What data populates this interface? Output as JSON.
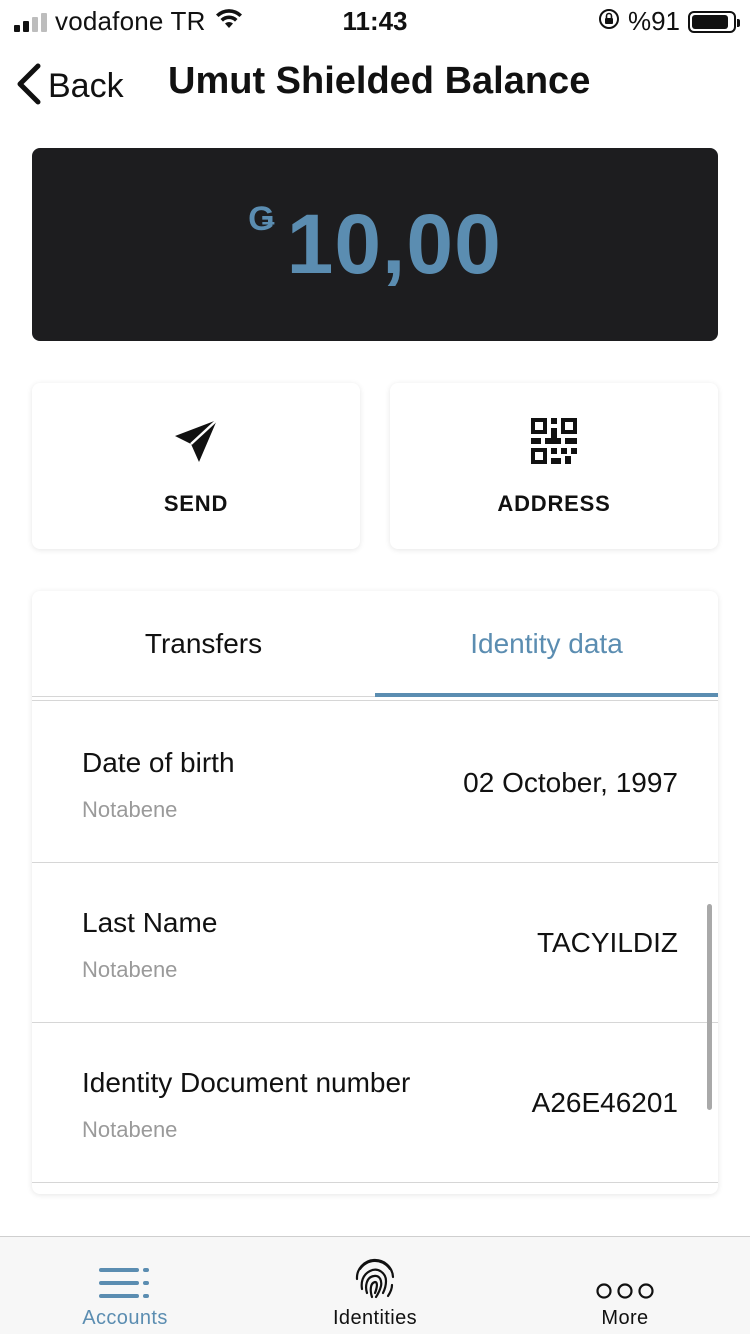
{
  "status_bar": {
    "carrier": "vodafone TR",
    "time": "11:43",
    "battery": "%91",
    "battery_level": 0.91,
    "signal_bars": 2
  },
  "header": {
    "back_label": "Back",
    "title": "Umut Shielded Balance"
  },
  "balance": {
    "currency_symbol": "Ǥ",
    "amount": "10,00",
    "color": "#5b8db1"
  },
  "actions": {
    "send_label": "SEND",
    "address_label": "ADDRESS",
    "send_icon": "send-icon",
    "address_icon": "qr-code-icon"
  },
  "tabs": {
    "transfers": "Transfers",
    "identity": "Identity data",
    "active": "identity"
  },
  "identity_rows": [
    {
      "label": "Date of birth",
      "source": "Notabene",
      "value": "02 October, 1997"
    },
    {
      "label": "Last Name",
      "source": "Notabene",
      "value": "TACYILDIZ"
    },
    {
      "label": "Identity Document number",
      "source": "Notabene",
      "value": "A26E46201"
    }
  ],
  "tabbar": {
    "accounts": "Accounts",
    "identities": "Identities",
    "more": "More",
    "active": "accounts",
    "accent": "#5b8db1"
  }
}
